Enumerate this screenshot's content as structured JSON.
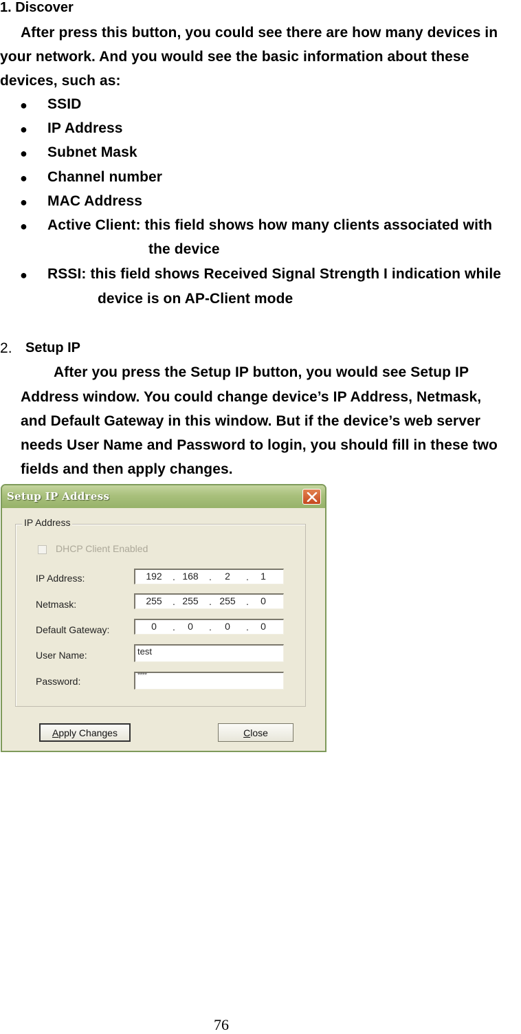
{
  "section1": {
    "heading": "1.   Discover",
    "para_lines": [
      "After press this button, you could see there are how many devices in",
      "your network. And you would see the basic information about these",
      "devices, such as:"
    ],
    "bullets": [
      "SSID",
      "IP Address",
      "Subnet Mask",
      "Channel number",
      "MAC Address",
      "Active Client: this field shows how many clients associated with",
      "RSSI: this field shows Received Signal Strength I indication while"
    ],
    "bullet_continuations": {
      "active_client": "the device",
      "rssi": "device is on AP-Client mode"
    },
    "bullet_glyph": "●"
  },
  "section2": {
    "number": "2.",
    "heading": "Setup IP",
    "para_lines": [
      "After you press the Setup IP button, you would see Setup IP",
      "Address window. You could change device’s IP Address, Netmask,",
      "and Default Gateway in this window. But if the device’s web server",
      "needs User Name and Password to login, you should fill in these two",
      "fields and then apply changes."
    ]
  },
  "dialog": {
    "title": "Setup IP Address",
    "close_icon": "close-x-icon",
    "group_label": "IP Address",
    "dhcp_label": "DHCP Client Enabled",
    "dhcp_checked": false,
    "fields": {
      "ip_label": "IP Address:",
      "ip": [
        "192",
        "168",
        "2",
        "1"
      ],
      "netmask_label": "Netmask:",
      "netmask": [
        "255",
        "255",
        "255",
        "0"
      ],
      "gateway_label": "Default Gateway:",
      "gateway": [
        "0",
        "0",
        "0",
        "0"
      ],
      "username_label": "User Name:",
      "username": "test",
      "password_label": "Password:",
      "password_masked": "****"
    },
    "buttons": {
      "apply_prefix": "A",
      "apply_rest": "pply Changes",
      "close_prefix": "C",
      "close_rest": "lose"
    }
  },
  "footer": {
    "page_number": "76"
  }
}
